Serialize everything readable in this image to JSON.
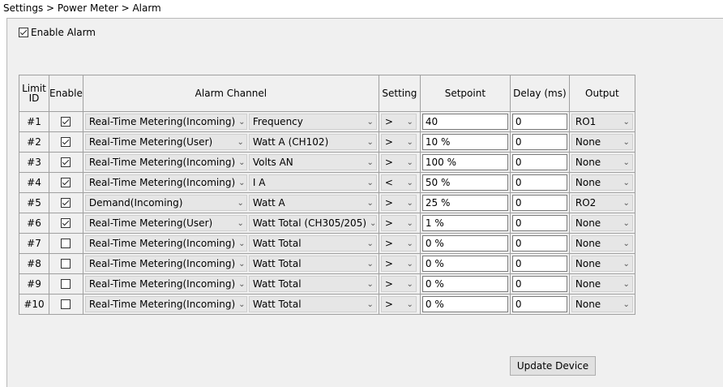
{
  "breadcrumb": "Settings > Power Meter > Alarm",
  "enable_alarm": {
    "label": "Enable Alarm",
    "checked": true
  },
  "columns": {
    "limit_id": "Limit ID",
    "enable": "Enable",
    "alarm_channel": "Alarm Channel",
    "setting": "Setting",
    "setpoint": "Setpoint",
    "delay": "Delay (ms)",
    "output": "Output"
  },
  "rows": [
    {
      "id": "#1",
      "enabled": true,
      "source": "Real-Time Metering(Incoming)",
      "param": "Frequency",
      "setting": ">",
      "setpoint": "40",
      "delay": "0",
      "output": "RO1"
    },
    {
      "id": "#2",
      "enabled": true,
      "source": "Real-Time Metering(User)",
      "param": "Watt A (CH102)",
      "setting": ">",
      "setpoint": "10 %",
      "delay": "0",
      "output": "None"
    },
    {
      "id": "#3",
      "enabled": true,
      "source": "Real-Time Metering(Incoming)",
      "param": "Volts AN",
      "setting": ">",
      "setpoint": "100 %",
      "delay": "0",
      "output": "None"
    },
    {
      "id": "#4",
      "enabled": true,
      "source": "Real-Time Metering(Incoming)",
      "param": "I A",
      "setting": "<",
      "setpoint": "50 %",
      "delay": "0",
      "output": "None"
    },
    {
      "id": "#5",
      "enabled": true,
      "source": "Demand(Incoming)",
      "param": "Watt A",
      "setting": ">",
      "setpoint": "25 %",
      "delay": "0",
      "output": "RO2"
    },
    {
      "id": "#6",
      "enabled": true,
      "source": "Real-Time Metering(User)",
      "param": "Watt Total (CH305/205)",
      "setting": ">",
      "setpoint": "1 %",
      "delay": "0",
      "output": "None"
    },
    {
      "id": "#7",
      "enabled": false,
      "source": "Real-Time Metering(Incoming)",
      "param": "Watt Total",
      "setting": ">",
      "setpoint": "0 %",
      "delay": "0",
      "output": "None"
    },
    {
      "id": "#8",
      "enabled": false,
      "source": "Real-Time Metering(Incoming)",
      "param": "Watt Total",
      "setting": ">",
      "setpoint": "0 %",
      "delay": "0",
      "output": "None"
    },
    {
      "id": "#9",
      "enabled": false,
      "source": "Real-Time Metering(Incoming)",
      "param": "Watt Total",
      "setting": ">",
      "setpoint": "0 %",
      "delay": "0",
      "output": "None"
    },
    {
      "id": "#10",
      "enabled": false,
      "source": "Real-Time Metering(Incoming)",
      "param": "Watt Total",
      "setting": ">",
      "setpoint": "0 %",
      "delay": "0",
      "output": "None"
    }
  ],
  "update_button": "Update Device",
  "icons": {
    "dropdown": "chevron-down-icon",
    "checkbox": "checkbox-icon"
  }
}
